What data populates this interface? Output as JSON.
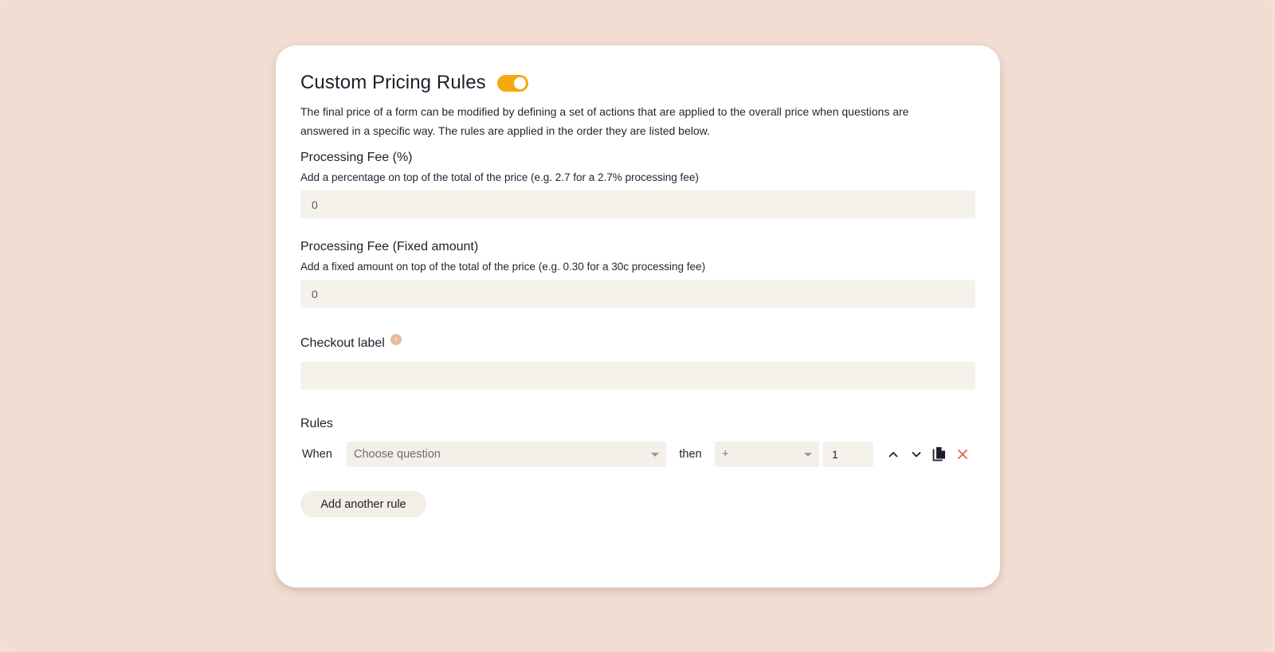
{
  "pricing": {
    "title": "Custom Pricing Rules",
    "toggle_on": true,
    "description": "The final price of a form can be modified by defining a set of actions that are applied to the overall price when questions are answered in a specific way. The rules are applied in the order they are listed below."
  },
  "processing_fee_percent": {
    "title": "Processing Fee (%)",
    "hint": "Add a percentage on top of the total of the price (e.g. 2.7 for a 2.7% processing fee)",
    "value": "0"
  },
  "processing_fee_fixed": {
    "title": "Processing Fee (Fixed amount)",
    "hint": "Add a fixed amount on top of the total of the price (e.g. 0.30 for a 30c processing fee)",
    "value": "0"
  },
  "checkout_label": {
    "title": "Checkout label",
    "info_icon": "i",
    "value": ""
  },
  "rules": {
    "title": "Rules",
    "items": [
      {
        "when_label": "When",
        "question_placeholder": "Choose question",
        "then_label": "then",
        "operator": "+",
        "amount": "1"
      }
    ],
    "add_label": "Add another rule"
  },
  "colors": {
    "background": "#f2ded3",
    "toggle": "#f5a80f",
    "delete": "#e0664a",
    "input_bg": "#f5f2ec"
  },
  "icons": [
    "info-icon",
    "chevron-up-icon",
    "chevron-down-icon",
    "copy-icon",
    "close-icon",
    "caret-down-icon"
  ]
}
